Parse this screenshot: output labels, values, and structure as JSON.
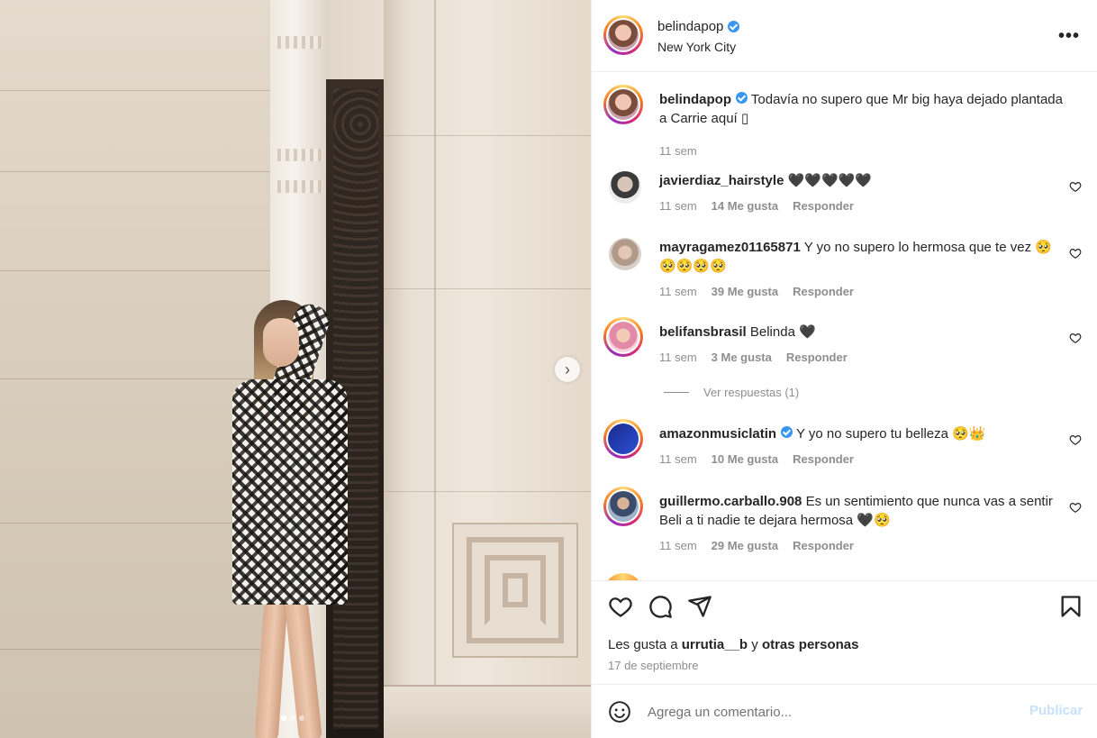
{
  "header": {
    "username": "belindapop",
    "location": "New York City",
    "more_glyph": "•••"
  },
  "caption": {
    "username": "belindapop",
    "text": "Todavía no supero que Mr big haya dejado plantada a Carrie aquí ▯",
    "time": "11 sem"
  },
  "comments": [
    {
      "username": "javierdiaz_hairstyle",
      "text": "🖤🖤🖤🖤🖤",
      "time": "11 sem",
      "likes": "14 Me gusta",
      "reply": "Responder"
    },
    {
      "username": "mayragamez01165871",
      "text": "Y yo no supero lo hermosa que te vez 🥺🥺🥺🥺🥺",
      "time": "11 sem",
      "likes": "39 Me gusta",
      "reply": "Responder"
    },
    {
      "username": "belifansbrasil",
      "text": "Belinda 🖤",
      "time": "11 sem",
      "likes": "3 Me gusta",
      "reply": "Responder"
    },
    {
      "username": "amazonmusiclatin",
      "text": "Y yo no supero tu belleza 🥺👑",
      "time": "11 sem",
      "likes": "10 Me gusta",
      "reply": "Responder"
    },
    {
      "username": "guillermo.carballo.908",
      "text": "Es un sentimiento que nunca vas a sentir Beli a ti nadie te dejara hermosa 🖤🥺",
      "time": "11 sem",
      "likes": "29 Me gusta",
      "reply": "Responder"
    }
  ],
  "view_replies": "Ver respuestas (1)",
  "likes_line": {
    "prefix": "Les gusta a",
    "user": "urrutia__b",
    "joiner": "y",
    "others": "otras personas"
  },
  "date": "17 de septiembre",
  "add_comment": {
    "placeholder": "Agrega un comentario...",
    "publish": "Publicar"
  },
  "media": {
    "next_glyph": "›",
    "slide_count": 3,
    "active_slide": 1
  },
  "colors": {
    "verified": "#3897f0",
    "muted": "#8e8e8e",
    "publish_disabled": "#c7e1fb"
  }
}
